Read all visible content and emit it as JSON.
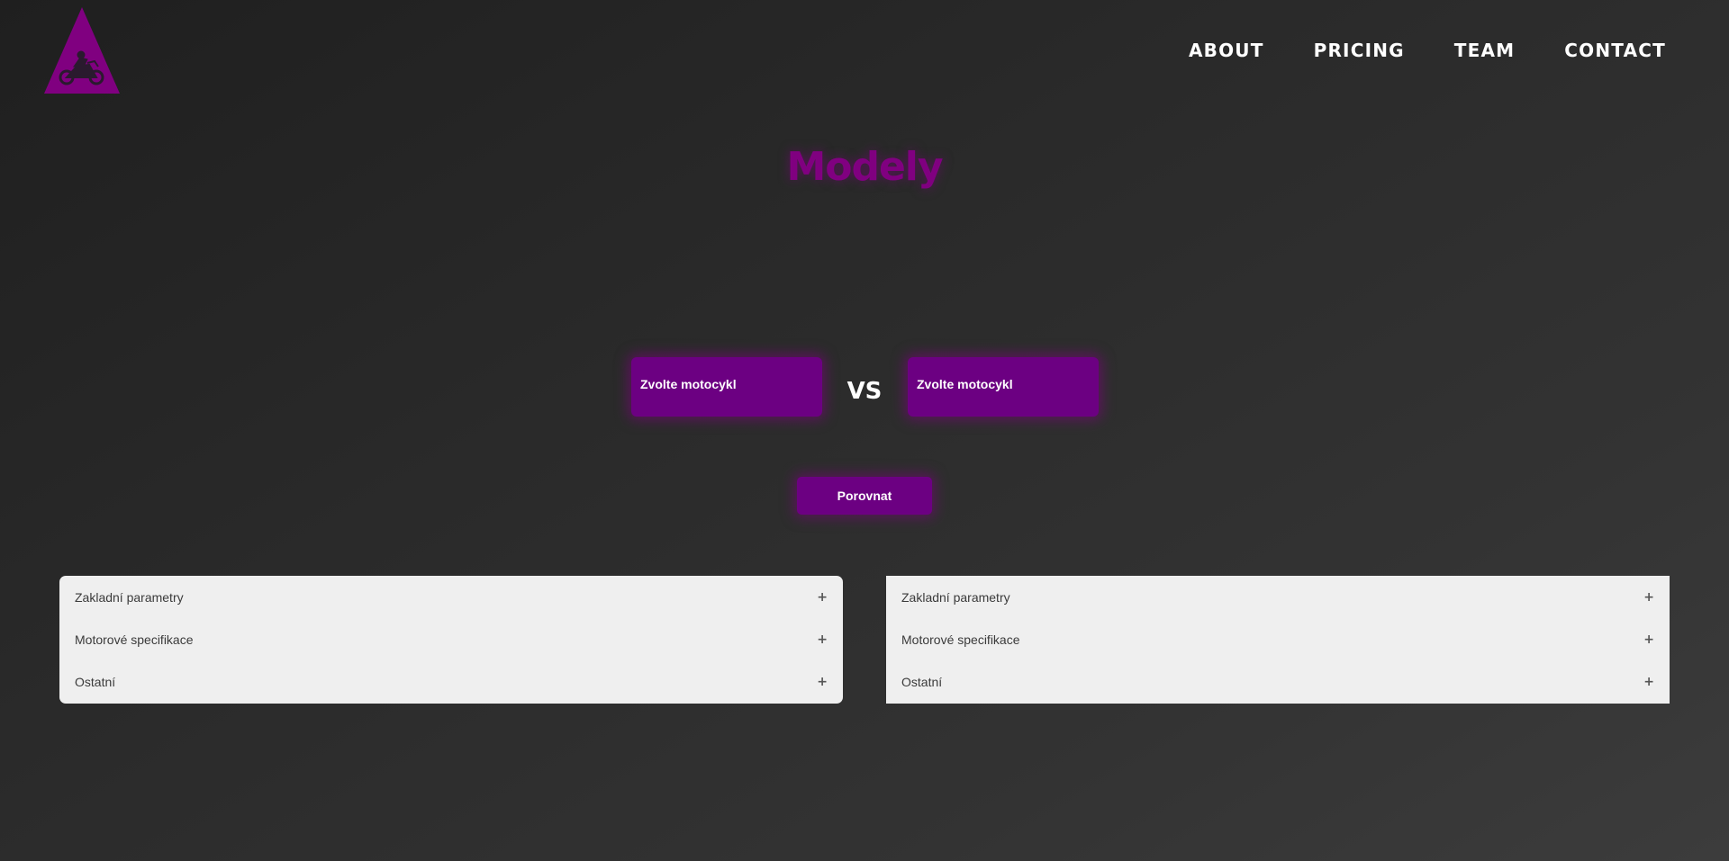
{
  "colors": {
    "accent": "#800080",
    "button_bg": "#6c0082",
    "panel_bg": "#efefef",
    "text_light": "#ffffff"
  },
  "logo": {
    "icon": "motorcycle-triangle-logo"
  },
  "nav": {
    "items": [
      {
        "label": "ABOUT"
      },
      {
        "label": "PRICING"
      },
      {
        "label": "TEAM"
      },
      {
        "label": "CONTACT"
      }
    ]
  },
  "main": {
    "title": "Modely",
    "select_left": "Zvolte motocykl",
    "select_right": "Zvolte motocykl",
    "vs": "VS",
    "compare_button": "Porovnat"
  },
  "panels": {
    "left": {
      "rows": [
        {
          "label": "Zakladní parametry",
          "icon": "+"
        },
        {
          "label": "Motorové specifikace",
          "icon": "+"
        },
        {
          "label": "Ostatní",
          "icon": "+"
        }
      ]
    },
    "right": {
      "rows": [
        {
          "label": "Zakladní parametry",
          "icon": "+"
        },
        {
          "label": "Motorové specifikace",
          "icon": "+"
        },
        {
          "label": "Ostatní",
          "icon": "+"
        }
      ]
    }
  }
}
